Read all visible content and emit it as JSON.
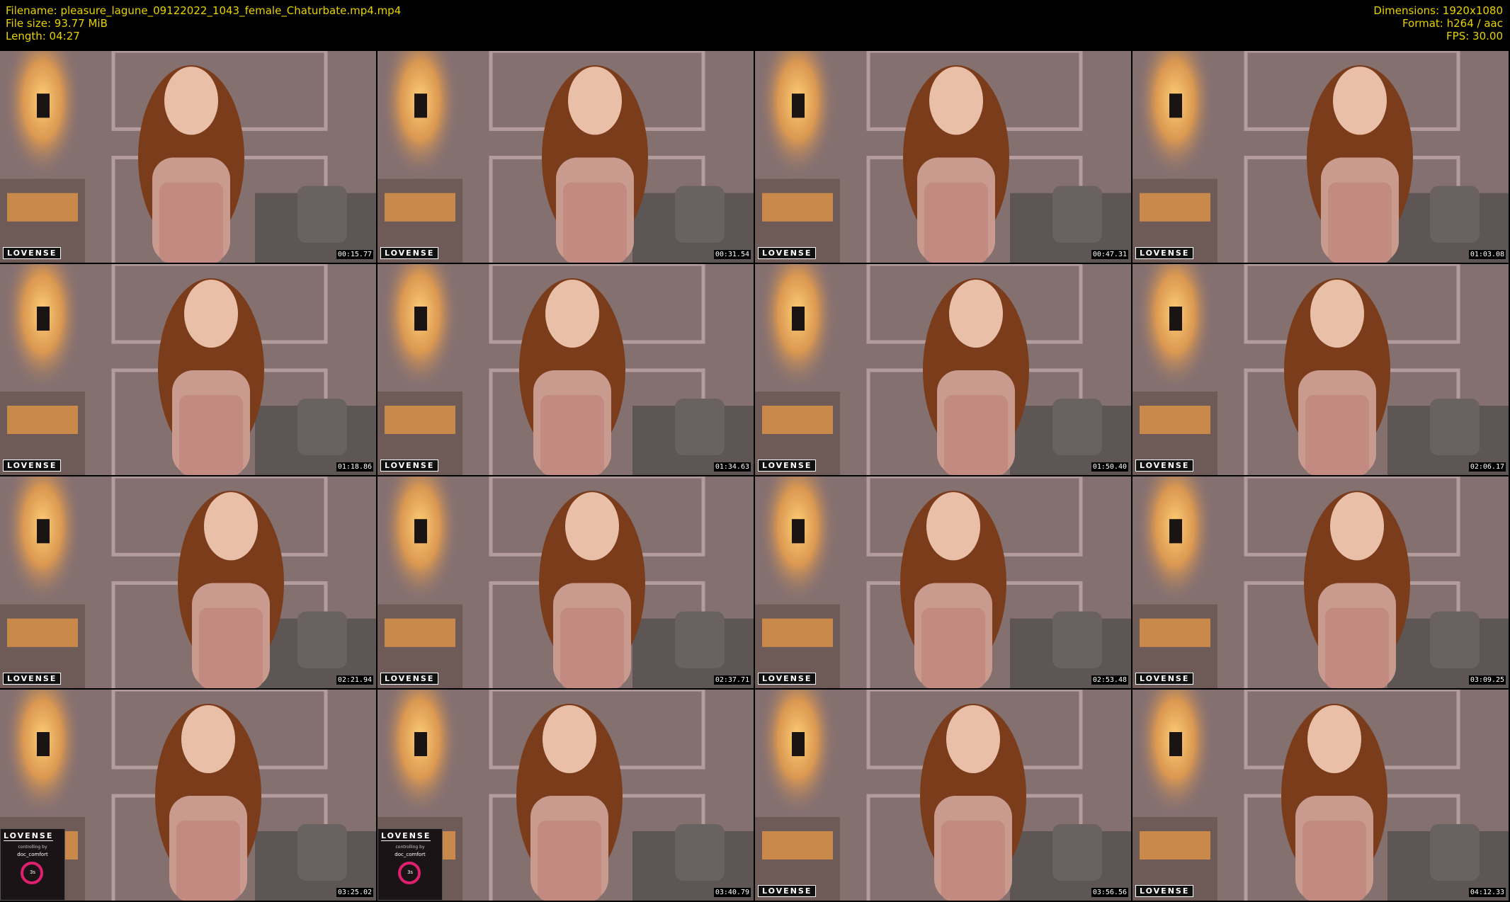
{
  "header": {
    "filename": "Filename: pleasure_lagune_09122022_1043_female_Chaturbate.mp4.mp4",
    "filesize": "File size: 93.77 MiB",
    "length": "Length: 04:27",
    "dimensions": "Dimensions: 1920x1080",
    "format": "Format: h264 / aac",
    "fps": "FPS: 30.00"
  },
  "overlay": {
    "logo_text": "LOVENSE",
    "widget_sub": "controlling by",
    "widget_user": "doc_comfort",
    "widget_time": "3s"
  },
  "colors": {
    "header_text": "#e8d200",
    "wall": "#8a7272",
    "lamp_glow": "#ffb347",
    "ring_accent": "#e0206f"
  },
  "frames": [
    {
      "timestamp": "00:15.77",
      "widget": false
    },
    {
      "timestamp": "00:31.54",
      "widget": false
    },
    {
      "timestamp": "00:47.31",
      "widget": false
    },
    {
      "timestamp": "01:03.08",
      "widget": false
    },
    {
      "timestamp": "01:18.86",
      "widget": false
    },
    {
      "timestamp": "01:34.63",
      "widget": false
    },
    {
      "timestamp": "01:50.40",
      "widget": false
    },
    {
      "timestamp": "02:06.17",
      "widget": false
    },
    {
      "timestamp": "02:21.94",
      "widget": false
    },
    {
      "timestamp": "02:37.71",
      "widget": false
    },
    {
      "timestamp": "02:53.48",
      "widget": false
    },
    {
      "timestamp": "03:09.25",
      "widget": false
    },
    {
      "timestamp": "03:25.02",
      "widget": true
    },
    {
      "timestamp": "03:40.79",
      "widget": true
    },
    {
      "timestamp": "03:56.56",
      "widget": false
    },
    {
      "timestamp": "04:12.33",
      "widget": false
    }
  ]
}
